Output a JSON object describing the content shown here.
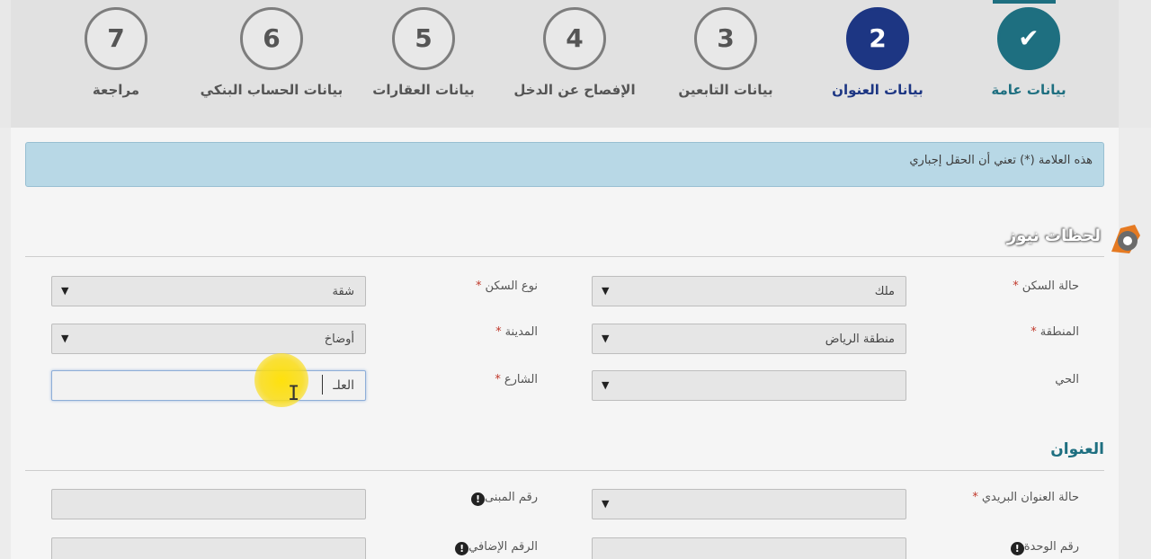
{
  "steps": [
    {
      "number": "✔",
      "label": "بيانات عامة",
      "state": "done"
    },
    {
      "number": "2",
      "label": "بيانات العنوان",
      "state": "active"
    },
    {
      "number": "3",
      "label": "بيانات التابعين",
      "state": "pending"
    },
    {
      "number": "4",
      "label": "الإفصاح عن الدخل",
      "state": "pending"
    },
    {
      "number": "5",
      "label": "بيانات العقارات",
      "state": "pending"
    },
    {
      "number": "6",
      "label": "بيانات الحساب البنكي",
      "state": "pending"
    },
    {
      "number": "7",
      "label": "مراجعة",
      "state": "pending"
    }
  ],
  "notice": "هذه العلامة (*) تعني أن الحقل إجباري",
  "required_mark": "*",
  "housing": {
    "housing_status": {
      "label": "حالة السكن",
      "value": "ملك"
    },
    "housing_type": {
      "label": "نوع السكن",
      "value": "شقة"
    },
    "region": {
      "label": "المنطقة",
      "value": "منطقة الرياض"
    },
    "city": {
      "label": "المدينة",
      "value": "أوضاخ"
    },
    "district": {
      "label": "الحي",
      "value": ""
    },
    "street": {
      "label": "الشارع",
      "value": "العلـ"
    }
  },
  "address": {
    "title": "العنوان",
    "postal_status": {
      "label": "حالة العنوان البريدي",
      "value": ""
    },
    "building_number": {
      "label": "رقم المبنى",
      "value": ""
    },
    "unit_number": {
      "label": "رقم الوحدة",
      "value": ""
    },
    "additional_number": {
      "label": "الرقم الإضافي",
      "value": ""
    }
  },
  "watermark": "لحظات نيوز",
  "colors": {
    "done": "#1e6f80",
    "active": "#1d3683",
    "notice_bg": "#b8d8e6",
    "cursor_highlight": "#ffe000"
  }
}
